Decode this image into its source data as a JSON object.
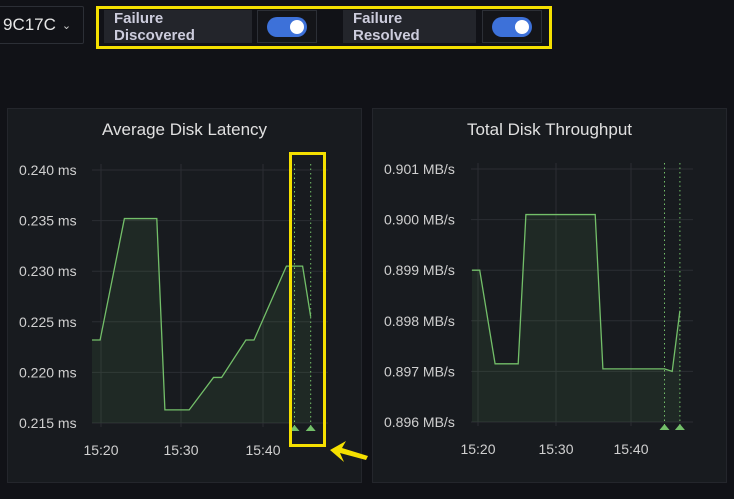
{
  "header": {
    "dropdown_value": "9C17C",
    "dropdown_icon": "chevron-down-icon",
    "toggles": [
      {
        "label": "Failure Discovered",
        "on": true
      },
      {
        "label": "Failure Resolved",
        "on": true
      }
    ]
  },
  "colors": {
    "series": "#73bf69",
    "highlight": "#f5e000",
    "toggle_on": "#3d71d9"
  },
  "chart_data": [
    {
      "type": "area",
      "title": "Average Disk Latency",
      "unit": "ms",
      "ylim": [
        0.215,
        0.24
      ],
      "yticks": [
        "0.240 ms",
        "0.235 ms",
        "0.230 ms",
        "0.225 ms",
        "0.220 ms",
        "0.215 ms"
      ],
      "xticks": [
        "15:20",
        "15:30",
        "15:40"
      ],
      "x_minutes": [
        0,
        1,
        4,
        5,
        8,
        9,
        11,
        12,
        15,
        16,
        19,
        20,
        24,
        25,
        26,
        27
      ],
      "values": [
        0.2232,
        0.2232,
        0.2352,
        0.2352,
        0.2352,
        0.2163,
        0.2163,
        0.2163,
        0.2195,
        0.2195,
        0.2232,
        0.2232,
        0.2305,
        0.2305,
        0.2305,
        0.2255
      ],
      "annotations_minutes": [
        25,
        27
      ],
      "grid": true
    },
    {
      "type": "area",
      "title": "Total Disk Throughput",
      "unit": "MB/s",
      "ylim": [
        0.896,
        0.901
      ],
      "yticks": [
        "0.901 MB/s",
        "0.900 MB/s",
        "0.899 MB/s",
        "0.898 MB/s",
        "0.897 MB/s",
        "0.896 MB/s"
      ],
      "xticks": [
        "15:20",
        "15:30",
        "15:40"
      ],
      "x_minutes": [
        0,
        1,
        3,
        6,
        7,
        12,
        16,
        17,
        24,
        25,
        26,
        27
      ],
      "values": [
        0.899,
        0.899,
        0.89715,
        0.89715,
        0.9001,
        0.9001,
        0.9001,
        0.89705,
        0.89705,
        0.89705,
        0.897,
        0.8982
      ],
      "annotations_minutes": [
        25,
        27
      ],
      "grid": true
    }
  ]
}
